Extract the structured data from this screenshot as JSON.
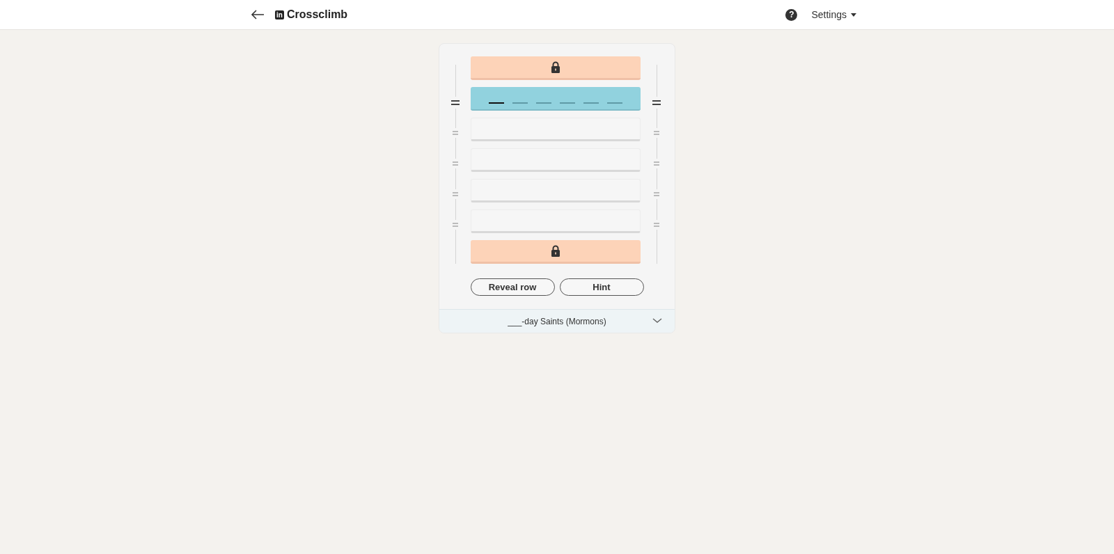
{
  "header": {
    "logo_text": "in",
    "title": "Crossclimb",
    "help_glyph": "?",
    "settings_label": "Settings"
  },
  "rows": [
    {
      "kind": "locked"
    },
    {
      "kind": "active",
      "slots": [
        {
          "selected": true
        },
        {
          "selected": false
        },
        {
          "selected": false
        },
        {
          "selected": false
        },
        {
          "selected": false
        },
        {
          "selected": false
        }
      ]
    },
    {
      "kind": "empty"
    },
    {
      "kind": "empty"
    },
    {
      "kind": "empty"
    },
    {
      "kind": "empty"
    },
    {
      "kind": "locked"
    }
  ],
  "buttons": [
    "Reveal row",
    "Hint"
  ],
  "clue": {
    "text": "___-day Saints (Mormons)",
    "expanded": false
  }
}
